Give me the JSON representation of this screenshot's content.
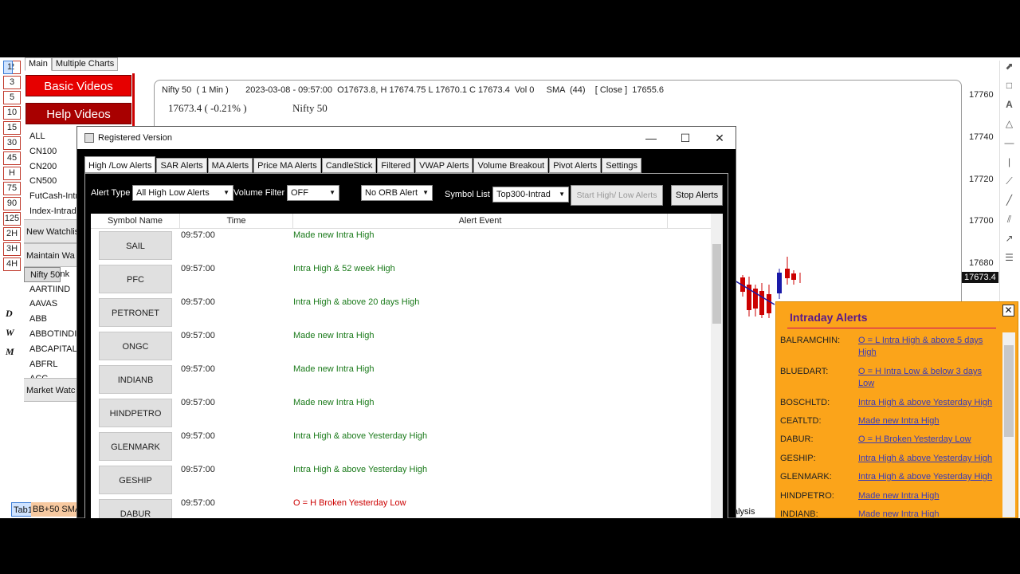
{
  "top_tabs": [
    "Main",
    "Multiple Charts"
  ],
  "timeframes": [
    "1",
    "2",
    "3",
    "5",
    "10",
    "15",
    "30",
    "45",
    "H",
    "75",
    "90",
    "125",
    "2H",
    "3H",
    "4H"
  ],
  "tool_letters": [
    "D",
    "W",
    "M"
  ],
  "buttons": {
    "basic_videos": "Basic Videos",
    "help_videos": "Help Videos"
  },
  "watchlist": {
    "groups": [
      "ALL",
      "CN100",
      "CN200",
      "CN500",
      "FutCash-Intr",
      "Index-Intrad"
    ],
    "new_watchlist": "New Watchlis",
    "maintain": "Maintain Wa",
    "symbols": [
      "Nifty 50",
      "Nifty Bank",
      "AARTIIND",
      "AAVAS",
      "ABB",
      "ABBOTINDIA",
      "ABCAPITAL",
      "ABFRL",
      "ACC"
    ],
    "market_watch": "Market Watc"
  },
  "chart": {
    "header": "Nifty 50  ( 1 Min )       2023-03-08 - 09:57:00  O17673.8, H 17674.75 L 17670.1 C 17673.4  Vol 0     SMA  (44)    [ Close ]  17655.6",
    "price_change": "17673.4 ( -0.21% )",
    "symbol": "Nifty 50",
    "y_ticks": [
      "17760",
      "17740",
      "17720",
      "17700",
      "17680"
    ],
    "last_price": "17673.4",
    "bottom_text": "alysis"
  },
  "bottom_tabs": [
    "Tab1",
    "BB+50 SMA"
  ],
  "dialog": {
    "title": "Registered Version",
    "tabs": [
      "High /Low Alerts",
      "SAR Alerts",
      "MA Alerts",
      "Price MA Alerts",
      "CandleStick",
      "Filtered",
      "VWAP Alerts",
      "Volume Breakout",
      "Pivot Alerts",
      "Settings"
    ],
    "alert_type_label": "Alert Type",
    "alert_type_value": "All High Low Alerts",
    "volume_filter_label": "Volume Filter",
    "volume_filter_value": "OFF",
    "orb_value": "No ORB Alert",
    "symbol_list_label": "Symbol List",
    "symbol_list_value": "Top300-Intrad",
    "start_button": "Start High/ Low Alerts",
    "stop_button": "Stop Alerts",
    "columns": [
      "Symbol Name",
      "Time",
      "Alert Event"
    ],
    "rows": [
      {
        "symbol": "SAIL",
        "time": "09:57:00",
        "event": "Made new Intra High"
      },
      {
        "symbol": "PFC",
        "time": "09:57:00",
        "event": "Intra High & 52 week High"
      },
      {
        "symbol": "PETRONET",
        "time": "09:57:00",
        "event": "Intra High & above 20 days High"
      },
      {
        "symbol": "ONGC",
        "time": "09:57:00",
        "event": "Made new Intra High"
      },
      {
        "symbol": "INDIANB",
        "time": "09:57:00",
        "event": "Made new Intra High"
      },
      {
        "symbol": "HINDPETRO",
        "time": "09:57:00",
        "event": "Made new Intra High"
      },
      {
        "symbol": "GLENMARK",
        "time": "09:57:00",
        "event": "Intra High & above Yesterday High"
      },
      {
        "symbol": "GESHIP",
        "time": "09:57:00",
        "event": "Intra High & above Yesterday High"
      },
      {
        "symbol": "DABUR",
        "time": "09:57:00",
        "event": "O = H  Broken Yesterday Low"
      }
    ]
  },
  "intraday_alerts": {
    "title": "Intraday Alerts",
    "items": [
      {
        "name": "BALRAMCHIN:",
        "desc": "O = L  Intra High & above 5 days High"
      },
      {
        "name": "BLUEDART:",
        "desc": "O = H  Intra Low & below 3 days Low"
      },
      {
        "name": "BOSCHLTD:",
        "desc": "Intra High & above Yesterday High"
      },
      {
        "name": "CEATLTD:",
        "desc": "Made new Intra High"
      },
      {
        "name": "DABUR:",
        "desc": "O = H  Broken Yesterday Low"
      },
      {
        "name": "GESHIP:",
        "desc": "Intra High & above Yesterday High"
      },
      {
        "name": "GLENMARK:",
        "desc": "Intra High & above Yesterday High"
      },
      {
        "name": "HINDPETRO:",
        "desc": "Made new Intra High"
      },
      {
        "name": "INDIANB:",
        "desc": "Made new Intra High"
      }
    ]
  },
  "colors": {
    "accent_red": "#e60000",
    "alert_panel": "#fba41a",
    "event_green": "#1a7a1a",
    "event_red": "#cc0000"
  }
}
